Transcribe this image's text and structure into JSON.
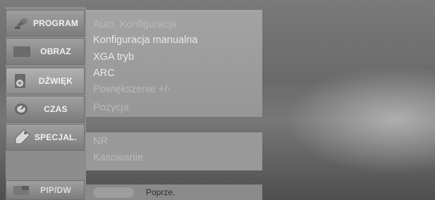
{
  "sidebar": {
    "items": [
      {
        "label": "PROGRAM",
        "icon": "satellite-dish-icon"
      },
      {
        "label": "OBRAZ",
        "icon": "picture-icon"
      },
      {
        "label": "DŹWIĘK",
        "icon": "speaker-icon"
      },
      {
        "label": "CZAS",
        "icon": "clock-icon"
      },
      {
        "label": "SPECJAL.",
        "icon": "tag-icon"
      },
      {
        "label": "PIP/DW",
        "icon": "pip-icon"
      }
    ]
  },
  "menu": {
    "items": [
      "Auto. Konfiguracja",
      "Konfiguracja manualna",
      "XGA tryb",
      "ARC",
      "Powiększenie +/-",
      "Pozycja"
    ],
    "items2": [
      "NR",
      "Kasowanie"
    ]
  },
  "footer": {
    "prev_label": "Poprze."
  }
}
